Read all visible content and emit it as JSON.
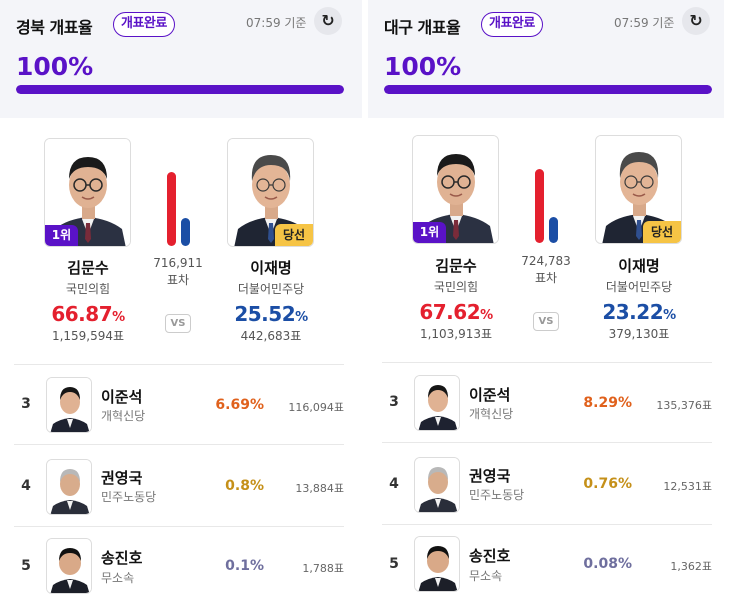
{
  "colors": {
    "accent_purple": "#5a12c7",
    "red": "#e4202e",
    "blue": "#1b4ea5",
    "orange": "#e0611c",
    "gold": "#c59019",
    "gray_purple": "#6f6f9e"
  },
  "icons": {
    "refresh": "refresh-icon"
  },
  "panels": [
    {
      "region_title": "경북 개표율",
      "status": "개표완료",
      "time": "07:59 기준",
      "progress_text": "100%",
      "progress_value": 100,
      "leader": {
        "rank_badge": "1위",
        "name": "김문수",
        "party": "국민의힘",
        "pct": "66.87",
        "pct_unit": "%",
        "votes": "1,159,594표",
        "share": 66.87
      },
      "winner": {
        "elected_badge": "당선",
        "name": "이재명",
        "party": "더불어민주당",
        "pct": "25.52",
        "pct_unit": "%",
        "votes": "442,683표",
        "share": 25.52
      },
      "margin": {
        "value": "716,911",
        "label": "표차"
      },
      "vs": "VS",
      "others": [
        {
          "rank": "3",
          "name": "이준석",
          "party": "개혁신당",
          "pct": "6.69%",
          "votes": "116,094표",
          "color": "#e0611c"
        },
        {
          "rank": "4",
          "name": "권영국",
          "party": "민주노동당",
          "pct": "0.8%",
          "votes": "13,884표",
          "color": "#c59019"
        },
        {
          "rank": "5",
          "name": "송진호",
          "party": "무소속",
          "pct": "0.1%",
          "votes": "1,788표",
          "color": "#6f6f9e"
        }
      ]
    },
    {
      "region_title": "대구 개표율",
      "status": "개표완료",
      "time": "07:59 기준",
      "progress_text": "100%",
      "progress_value": 100,
      "leader": {
        "rank_badge": "1위",
        "name": "김문수",
        "party": "국민의힘",
        "pct": "67.62",
        "pct_unit": "%",
        "votes": "1,103,913표",
        "share": 67.62
      },
      "winner": {
        "elected_badge": "당선",
        "name": "이재명",
        "party": "더불어민주당",
        "pct": "23.22",
        "pct_unit": "%",
        "votes": "379,130표",
        "share": 23.22
      },
      "margin": {
        "value": "724,783",
        "label": "표차"
      },
      "vs": "VS",
      "others": [
        {
          "rank": "3",
          "name": "이준석",
          "party": "개혁신당",
          "pct": "8.29%",
          "votes": "135,376표",
          "color": "#e0611c"
        },
        {
          "rank": "4",
          "name": "권영국",
          "party": "민주노동당",
          "pct": "0.76%",
          "votes": "12,531표",
          "color": "#c59019"
        },
        {
          "rank": "5",
          "name": "송진호",
          "party": "무소속",
          "pct": "0.08%",
          "votes": "1,362표",
          "color": "#6f6f9e"
        }
      ]
    }
  ]
}
